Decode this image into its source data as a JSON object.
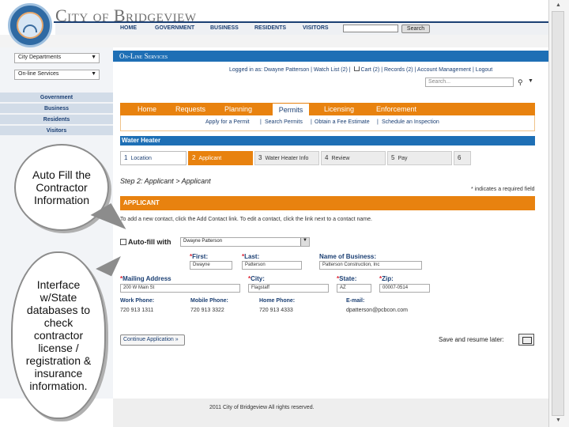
{
  "header": {
    "city_title": "City of Bridgeview",
    "nav": [
      "HOME",
      "GOVERNMENT",
      "BUSINESS",
      "RESIDENTS",
      "VISITORS"
    ],
    "search_button": "Search"
  },
  "sidebar": {
    "select1": "City Departments",
    "select2": "On-line Services",
    "links": [
      "Government",
      "Business",
      "Residents",
      "Visitors"
    ]
  },
  "callouts": {
    "autofill": "Auto Fill the Contractor Information",
    "interface": "Interface w/State databases to check contractor license / registration & insurance information."
  },
  "online_bar": "On-Line Services",
  "userbar": {
    "logged_in": "Logged in as: Dwayne Patterson",
    "watch": "Watch List (2)",
    "cart": "Cart (2)",
    "records": "Records (2)",
    "account": "Account Management",
    "logout": "Logout"
  },
  "search2_placeholder": "Search...",
  "tabs": [
    "Home",
    "Requests",
    "Planning",
    "Permits",
    "Licensing",
    "Enforcement"
  ],
  "subtabs": [
    "Apply for a Permit",
    "Search Permits",
    "Obtain a Fee Estimate",
    "Schedule an Inspection"
  ],
  "subtab_sep": "|",
  "permit_title": "Water Heater",
  "steps": [
    {
      "num": "1",
      "label": "Location"
    },
    {
      "num": "2",
      "label": "Applicant"
    },
    {
      "num": "3",
      "label": "Water Heater Info"
    },
    {
      "num": "4",
      "label": "Review"
    },
    {
      "num": "5",
      "label": "Pay"
    },
    {
      "num": "6",
      "label": ""
    }
  ],
  "step_title": "Step 2: Applicant > Applicant",
  "required_note": "* indicates a required field",
  "section_title": "APPLICANT",
  "instructions": "To add a new contact, click the Add Contact link. To edit a contact, click the link next to a contact name.",
  "autofill": {
    "label": "Auto-fill with",
    "value": "Dwayne Patterson"
  },
  "fields": {
    "first": {
      "label": "First:",
      "value": "Dwayne"
    },
    "last": {
      "label": "Last:",
      "value": "Patterson"
    },
    "business": {
      "label": "Name of Business:",
      "value": "Patterson Construction, Inc"
    },
    "mailing": {
      "label": "Mailing Address",
      "value": "200 W Main St"
    },
    "city": {
      "label": "City:",
      "value": "Flagstaff"
    },
    "state": {
      "label": "State:",
      "value": "AZ"
    },
    "zip": {
      "label": "Zip:",
      "value": "00007-0514"
    }
  },
  "req_mark": "*",
  "phones": {
    "work": {
      "label": "Work Phone:",
      "value": "720 913 1311"
    },
    "mobile": {
      "label": "Mobile Phone:",
      "value": "720 913 3322"
    },
    "home": {
      "label": "Home Phone:",
      "value": "720 913 4333"
    },
    "email": {
      "label": "E-mail:",
      "value": "dpatterson@pcbcon.com"
    }
  },
  "continue_button": "Continue Application »",
  "save_label": "Save and resume later:",
  "footer": "2011 City of Bridgeview All rights reserved.",
  "colors": {
    "orange": "#e8820f",
    "blue": "#1e6fb5",
    "navy": "#1b3f73"
  }
}
